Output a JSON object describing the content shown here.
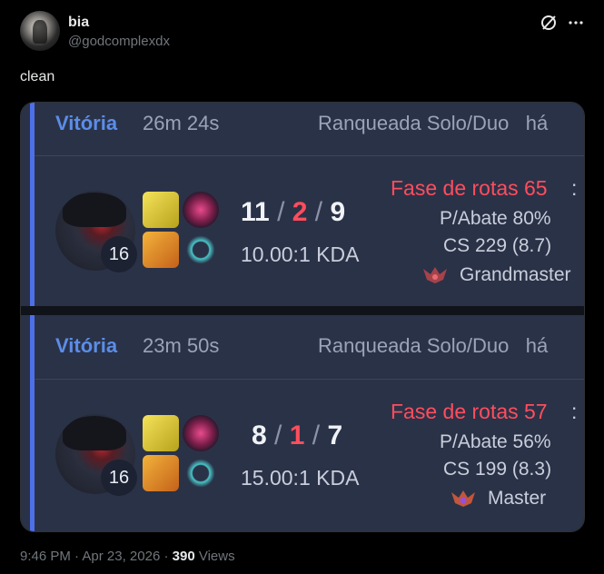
{
  "tweet": {
    "author_name": "bia",
    "author_handle": "@godcomplexdx",
    "text": "clean",
    "time": "9:46 PM",
    "date": "Apr 23, 2026",
    "views_count": "390",
    "views_label": "Views",
    "dot": "·"
  },
  "matches": [
    {
      "result": "Vitória",
      "duration": "26m 24s",
      "queue": "Ranqueada Solo/Duo",
      "ago": "há",
      "level": "16",
      "kills": "11",
      "deaths": "2",
      "assists": "9",
      "slash": "/",
      "kda": "10.00:1 KDA",
      "lane_phase": "Fase de rotas 65",
      "colon": ":",
      "kill_participation": "P/Abate 80%",
      "cs": "CS 229 (8.7)",
      "rank": "Grandmaster"
    },
    {
      "result": "Vitória",
      "duration": "23m 50s",
      "queue": "Ranqueada Solo/Duo",
      "ago": "há",
      "level": "16",
      "kills": "8",
      "deaths": "1",
      "assists": "7",
      "slash": "/",
      "kda": "15.00:1 KDA",
      "lane_phase": "Fase de rotas 57",
      "colon": ":",
      "kill_participation": "P/Abate 56%",
      "cs": "CS 199 (8.3)",
      "rank": "Master"
    }
  ],
  "colors": {
    "win_blue": "#5b8de8",
    "death_red": "#ff4d5e",
    "card_bg": "#2a3247"
  }
}
